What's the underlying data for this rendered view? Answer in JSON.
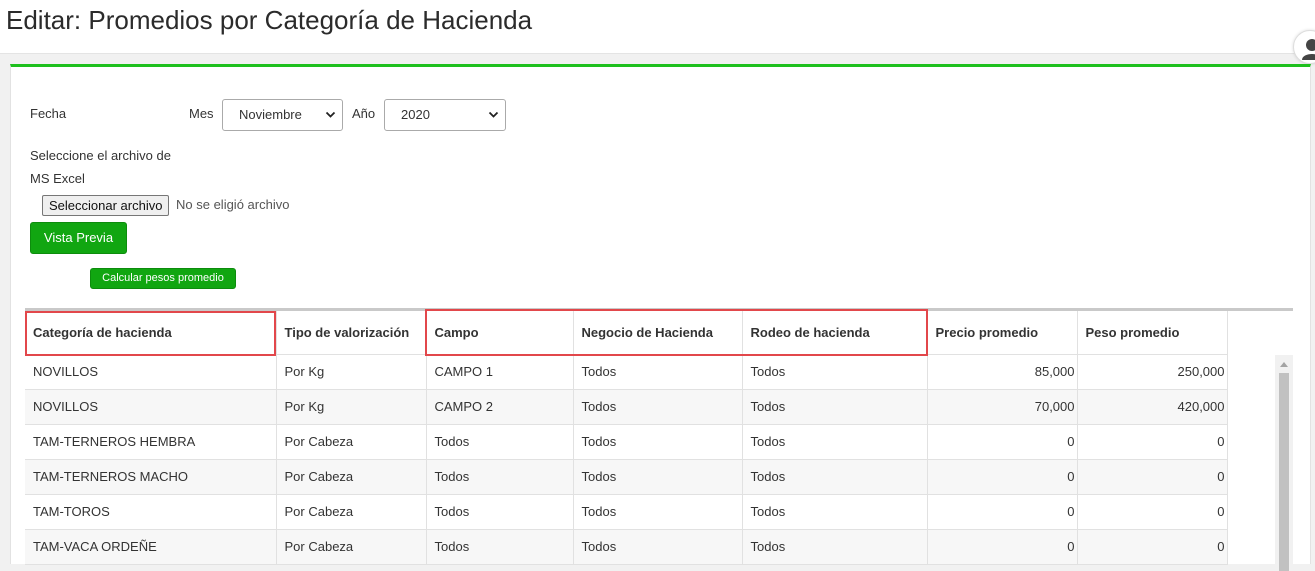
{
  "page": {
    "title": "Editar: Promedios por Categoría de Hacienda"
  },
  "form": {
    "fecha_label": "Fecha",
    "mes_label": "Mes",
    "mes_value": "Noviembre",
    "anio_label": "Año",
    "anio_value": "2020",
    "file_label_line1": "Seleccione el archivo de",
    "file_label_line2": "MS Excel",
    "file_button": "Seleccionar archivo",
    "file_status": "No se eligió archivo",
    "preview_button": "Vista Previa",
    "calc_button": "Calcular pesos promedio"
  },
  "table": {
    "columns": [
      "Categoría de hacienda",
      "Tipo de valorización",
      "Campo",
      "Negocio de Hacienda",
      "Rodeo de hacienda",
      "Precio promedio",
      "Peso promedio"
    ],
    "rows": [
      [
        "NOVILLOS",
        "Por Kg",
        "CAMPO 1",
        "Todos",
        "Todos",
        "85,000",
        "250,000"
      ],
      [
        "NOVILLOS",
        "Por Kg",
        "CAMPO 2",
        "Todos",
        "Todos",
        "70,000",
        "420,000"
      ],
      [
        "TAM-TERNEROS HEMBRA",
        "Por Cabeza",
        "Todos",
        "Todos",
        "Todos",
        "0",
        "0"
      ],
      [
        "TAM-TERNEROS MACHO",
        "Por Cabeza",
        "Todos",
        "Todos",
        "Todos",
        "0",
        "0"
      ],
      [
        "TAM-TOROS",
        "Por Cabeza",
        "Todos",
        "Todos",
        "Todos",
        "0",
        "0"
      ],
      [
        "TAM-VACA ORDEÑE",
        "Por Cabeza",
        "Todos",
        "Todos",
        "Todos",
        "0",
        "0"
      ]
    ]
  },
  "colors": {
    "accent": "#11a611",
    "highlight": "#e2474b",
    "panel_border": "#1ec01e"
  }
}
